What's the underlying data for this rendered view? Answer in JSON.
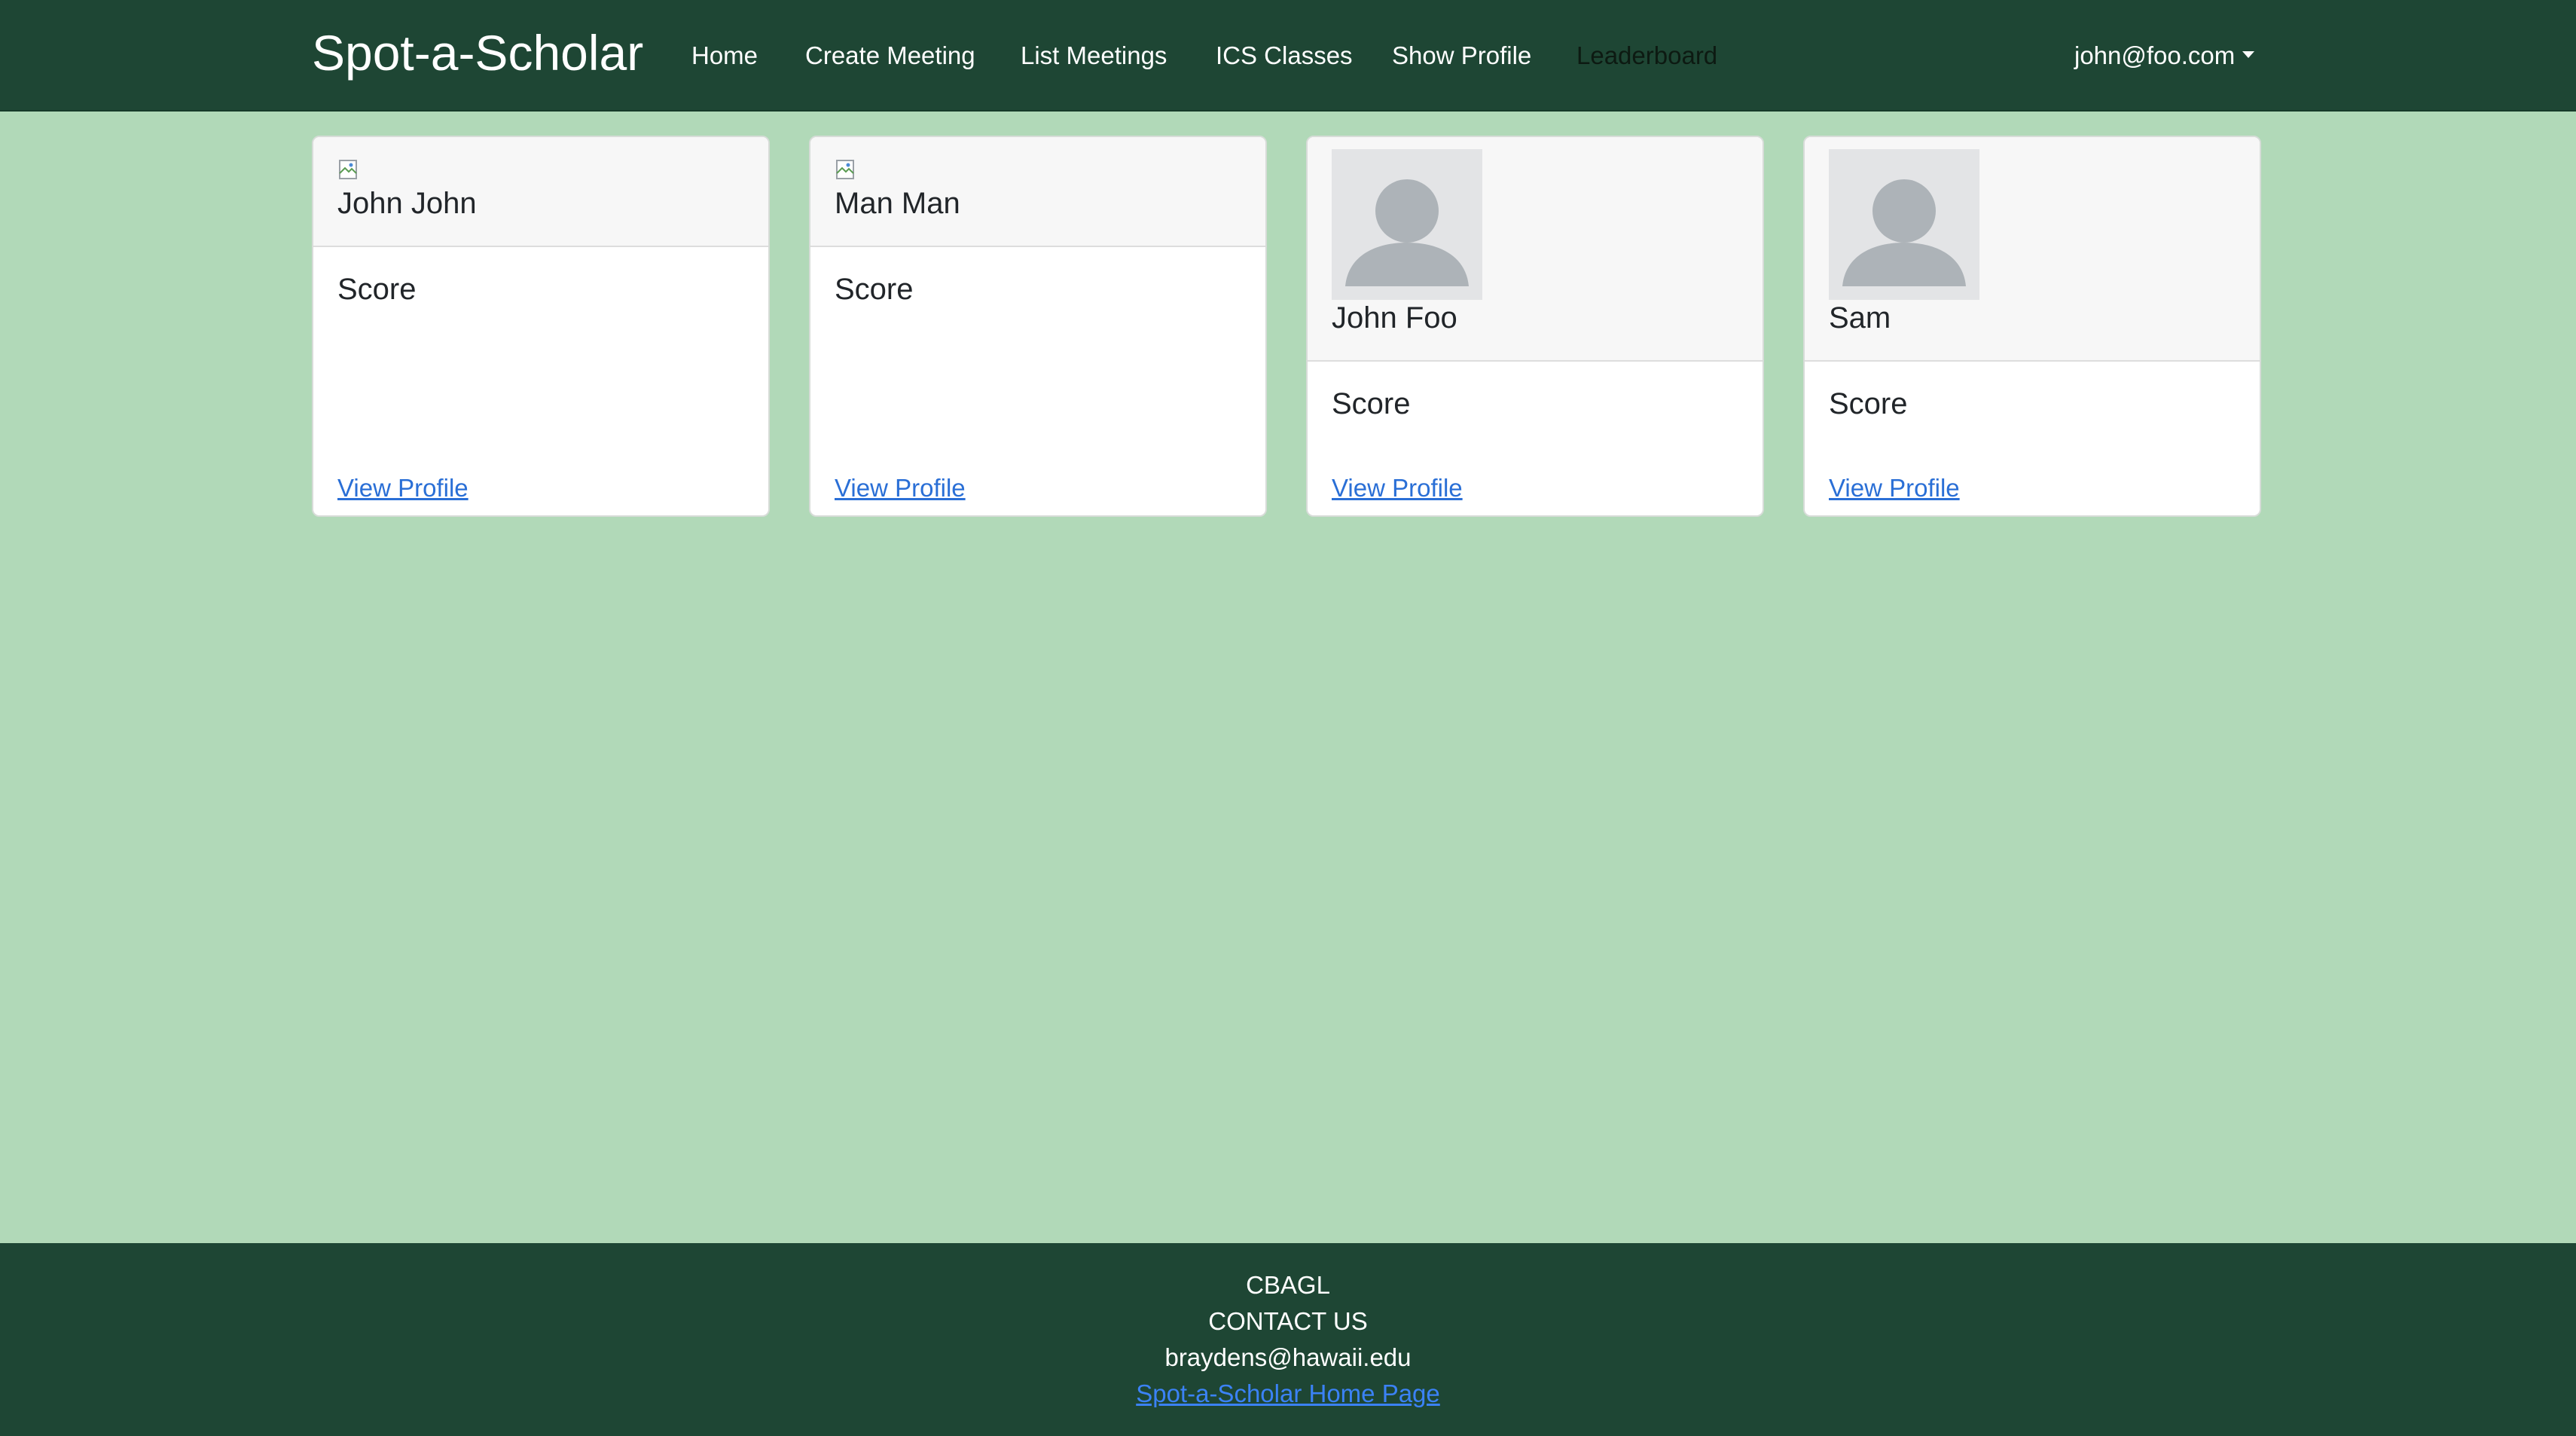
{
  "navbar": {
    "brand": "Spot-a-Scholar",
    "links": [
      {
        "label": "Home"
      },
      {
        "label": "Create Meeting"
      },
      {
        "label": "List Meetings"
      },
      {
        "label": "ICS Classes"
      },
      {
        "label": "Show Profile"
      },
      {
        "label": "Leaderboard",
        "active": true
      }
    ],
    "user_email": "john@foo.com"
  },
  "leaderboard": {
    "cards": [
      {
        "name": "John John",
        "image": "broken-image-icon",
        "score_label": "Score",
        "link_label": "View Profile"
      },
      {
        "name": "Man Man",
        "image": "broken-image-icon",
        "score_label": "Score",
        "link_label": "View Profile"
      },
      {
        "name": "John Foo",
        "image": "default-avatar-icon",
        "score_label": "Score",
        "link_label": "View Profile"
      },
      {
        "name": "Sam",
        "image": "default-avatar-icon",
        "score_label": "Score",
        "link_label": "View Profile"
      }
    ]
  },
  "footer": {
    "org": "CBAGL",
    "contact_heading": "CONTACT US",
    "email": "braydens@hawaii.edu",
    "home_link": "Spot-a-Scholar Home Page"
  },
  "colors": {
    "navbar_bg": "#1e4634",
    "page_bg": "#b1d9b8",
    "link": "#2a6fd6"
  }
}
